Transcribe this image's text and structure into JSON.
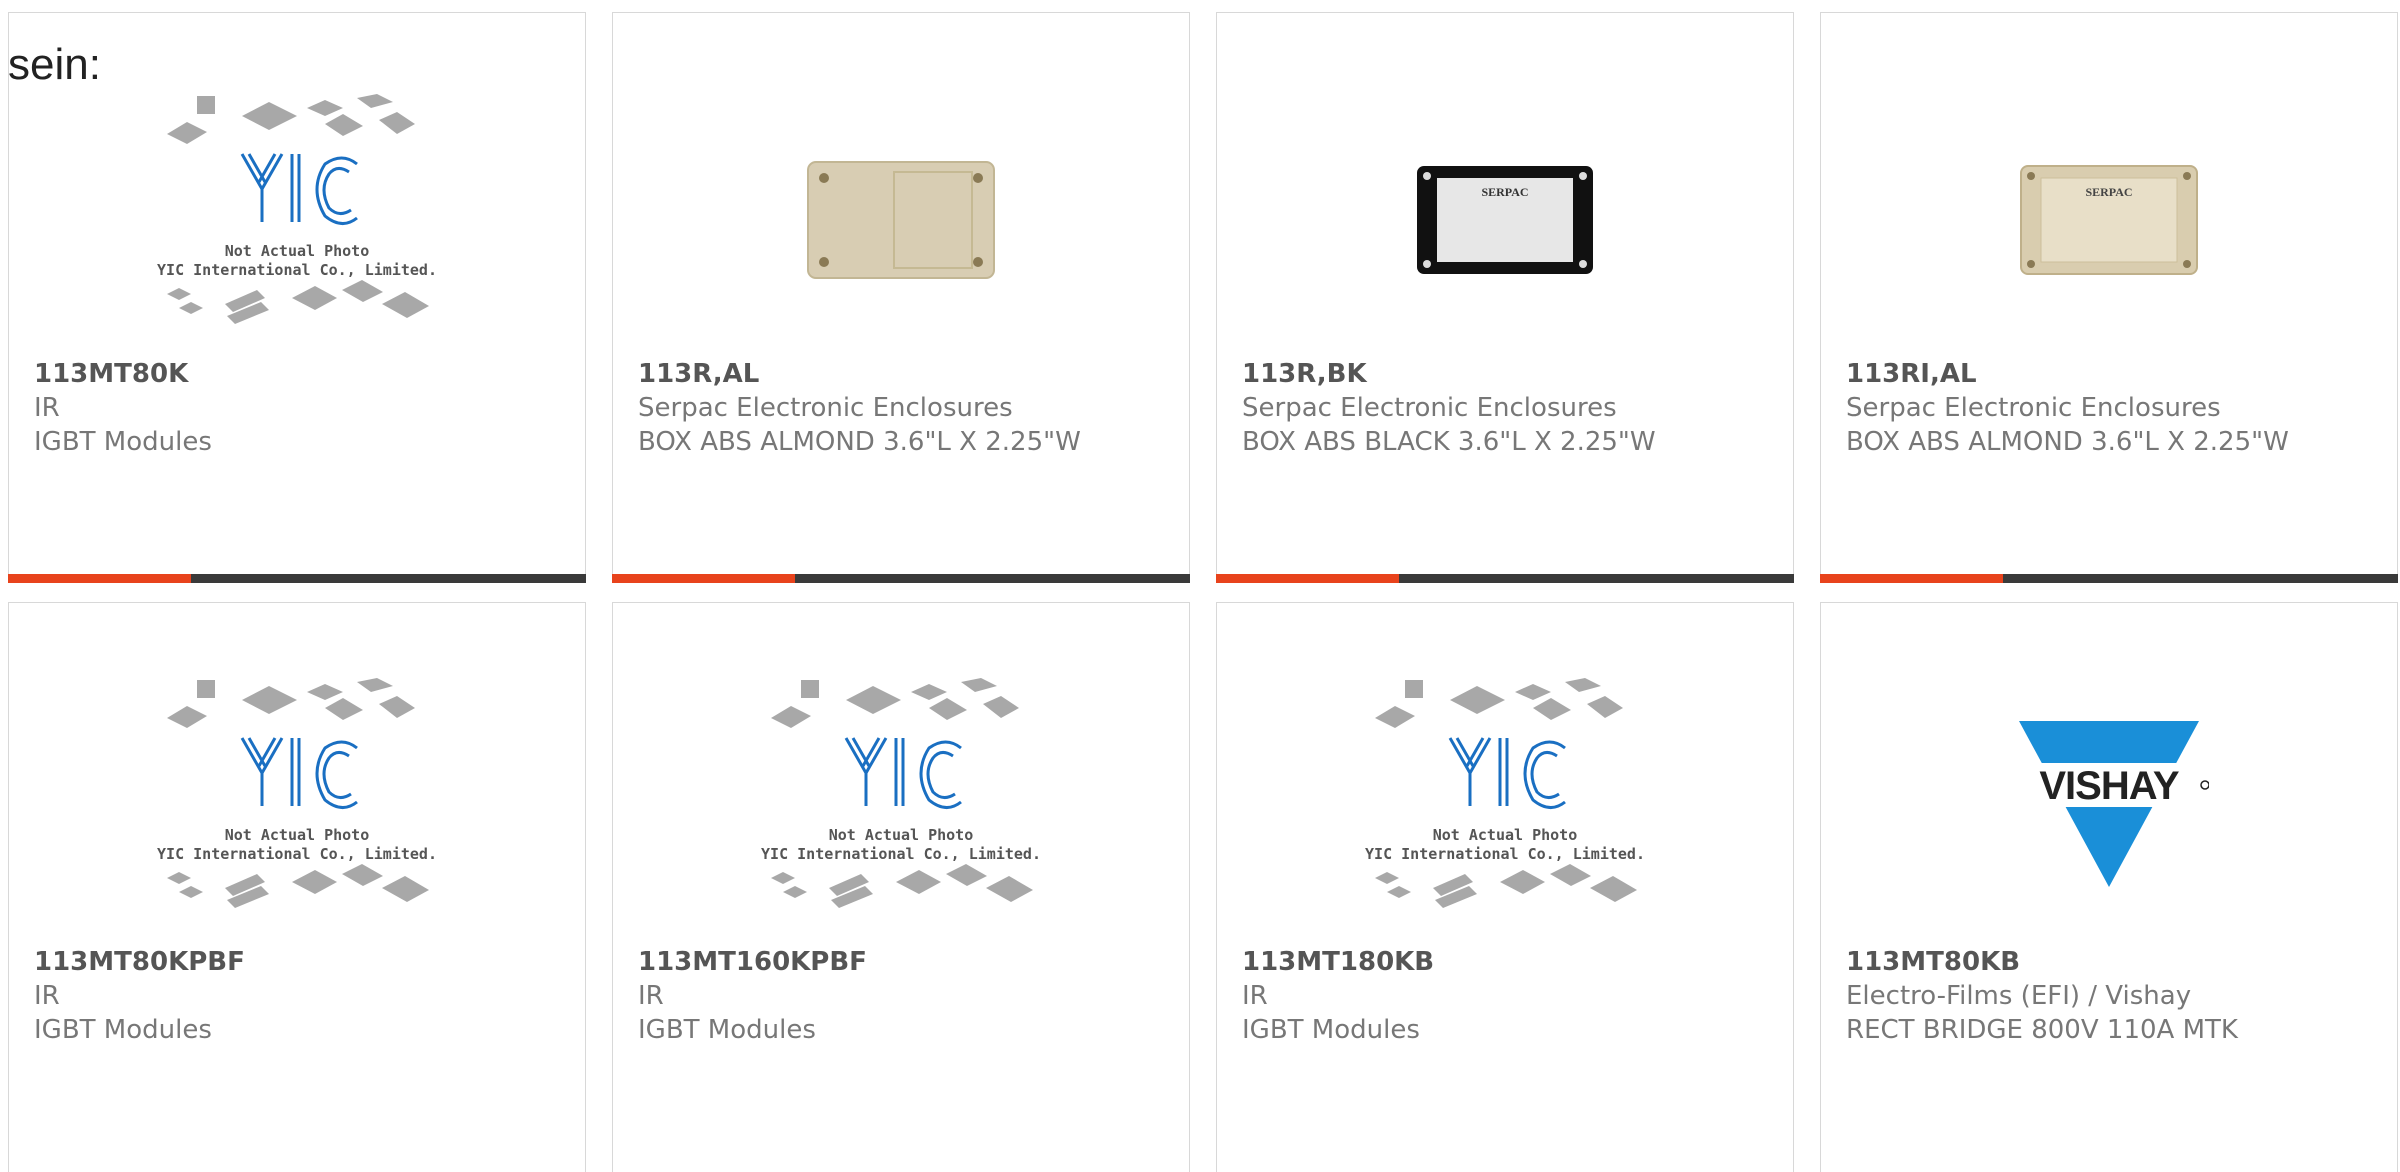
{
  "intro_text": "sein:",
  "colors": {
    "accent": "#e8431c",
    "bar": "#3a3a3a",
    "yic_blue": "#1a6fc2",
    "vishay_blue": "#1a8fd8"
  },
  "placeholder": {
    "line1": "Not Actual Photo",
    "line2": "YIC International Co., Limited.",
    "logo_text": "YIC"
  },
  "vishay_logo_text": "VISHAY",
  "serpac_label": "SERPAC",
  "products": [
    {
      "part": "113MT80K",
      "maker": "IR",
      "desc": "IGBT Modules",
      "image": "yic-placeholder"
    },
    {
      "part": "113R,AL",
      "maker": "Serpac Electronic Enclosures",
      "desc": "BOX ABS ALMOND 3.6\"L X 2.25\"W",
      "image": "almond-box"
    },
    {
      "part": "113R,BK",
      "maker": "Serpac Electronic Enclosures",
      "desc": "BOX ABS BLACK 3.6\"L X 2.25\"W",
      "image": "black-box"
    },
    {
      "part": "113RI,AL",
      "maker": "Serpac Electronic Enclosures",
      "desc": "BOX ABS ALMOND 3.6\"L X 2.25\"W",
      "image": "almond-box-label"
    },
    {
      "part": "113MT80KPBF",
      "maker": "IR",
      "desc": "IGBT Modules",
      "image": "yic-placeholder"
    },
    {
      "part": "113MT160KPBF",
      "maker": "IR",
      "desc": "IGBT Modules",
      "image": "yic-placeholder"
    },
    {
      "part": "113MT180KB",
      "maker": "IR",
      "desc": "IGBT Modules",
      "image": "yic-placeholder"
    },
    {
      "part": "113MT80KB",
      "maker": "Electro-Films (EFI) / Vishay",
      "desc": "RECT BRIDGE 800V 110A MTK",
      "image": "vishay-logo"
    }
  ]
}
